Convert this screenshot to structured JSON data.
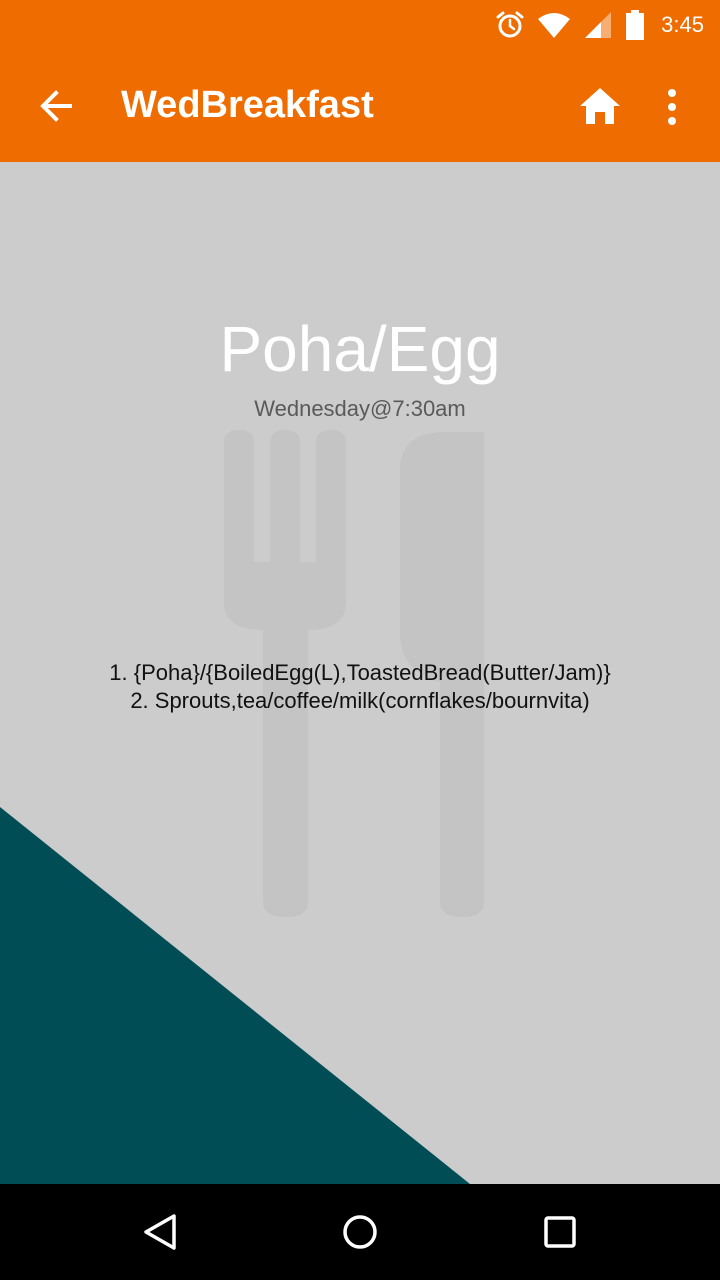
{
  "status_bar": {
    "time": "3:45",
    "icons": [
      "alarm-icon",
      "wifi-icon",
      "signal-icon",
      "battery-icon"
    ]
  },
  "app_bar": {
    "title": "WedBreakfast",
    "icons": [
      "back-arrow-icon",
      "home-icon",
      "more-vert-icon"
    ]
  },
  "meal": {
    "name": "Poha/Egg",
    "schedule": "Wednesday@7:30am",
    "items": [
      "1. {Poha}/{BoiledEgg(L),ToastedBread(Butter/Jam)}",
      "2. Sprouts,tea/coffee/milk(cornflakes/bournvita)"
    ]
  },
  "nav_bar": {
    "icons": [
      "back-triangle-icon",
      "home-circle-icon",
      "recents-square-icon"
    ]
  },
  "colors": {
    "accent": "#ef6c00",
    "background": "#cccccc",
    "teal": "#004d55",
    "cutlery": "#c4c4c4"
  }
}
